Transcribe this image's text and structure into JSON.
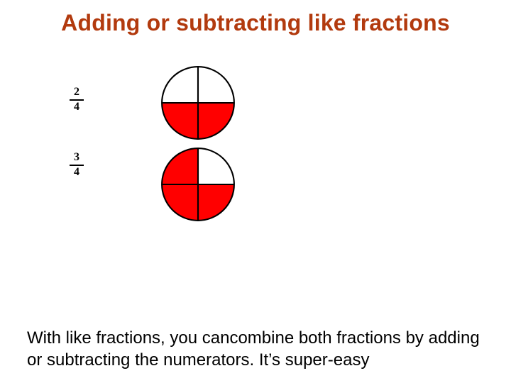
{
  "title": "Adding or subtracting like fractions",
  "fractions": [
    {
      "num": "2",
      "den": "4"
    },
    {
      "num": "3",
      "den": "4"
    }
  ],
  "body": "With like fractions, you cancombine both fractions by adding or subtracting the numerators. It’s super-easy",
  "colors": {
    "accent": "#b23a0e",
    "fill": "#ff0000"
  },
  "chart_data": [
    {
      "type": "pie",
      "title": "2/4",
      "categories": [
        "filled",
        "empty"
      ],
      "values": [
        2,
        2
      ]
    },
    {
      "type": "pie",
      "title": "3/4",
      "categories": [
        "filled",
        "empty"
      ],
      "values": [
        3,
        1
      ]
    }
  ]
}
